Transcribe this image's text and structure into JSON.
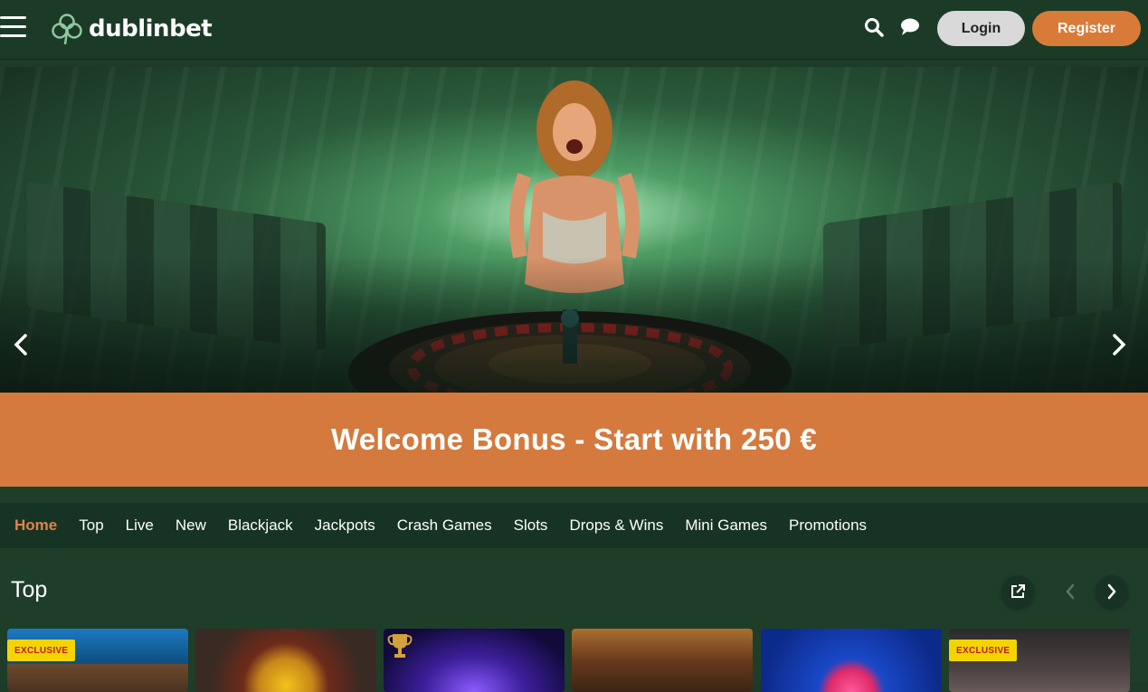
{
  "header": {
    "logo_text": "dublinbet",
    "login_label": "Login",
    "register_label": "Register",
    "search_icon": "search-icon",
    "chat_icon": "chat-icon",
    "menu_icon": "hamburger-menu-icon"
  },
  "hero": {
    "prev_icon": "chevron-left-icon",
    "next_icon": "chevron-right-icon"
  },
  "welcome": {
    "text": "Welcome Bonus - Start with 250 €"
  },
  "categories": [
    {
      "label": "Home",
      "active": true
    },
    {
      "label": "Top"
    },
    {
      "label": "Live"
    },
    {
      "label": "New"
    },
    {
      "label": "Blackjack"
    },
    {
      "label": "Jackpots"
    },
    {
      "label": "Crash Games"
    },
    {
      "label": "Slots"
    },
    {
      "label": "Drops & Wins"
    },
    {
      "label": "Mini Games"
    },
    {
      "label": "Promotions"
    }
  ],
  "top_section": {
    "title": "Top",
    "external_icon": "external-link-icon",
    "prev_icon": "chevron-left-icon",
    "next_icon": "chevron-right-icon"
  },
  "tiles": [
    {
      "badge": "EXCLUSIVE"
    },
    {
      "badge": ""
    },
    {
      "badge": ""
    },
    {
      "badge": ""
    },
    {
      "badge": ""
    },
    {
      "badge": "EXCLUSIVE"
    }
  ],
  "colors": {
    "accent": "#d97b38",
    "header_bg": "#1c3b27",
    "nav_bg": "#163323",
    "badge_bg": "#f4d400"
  }
}
